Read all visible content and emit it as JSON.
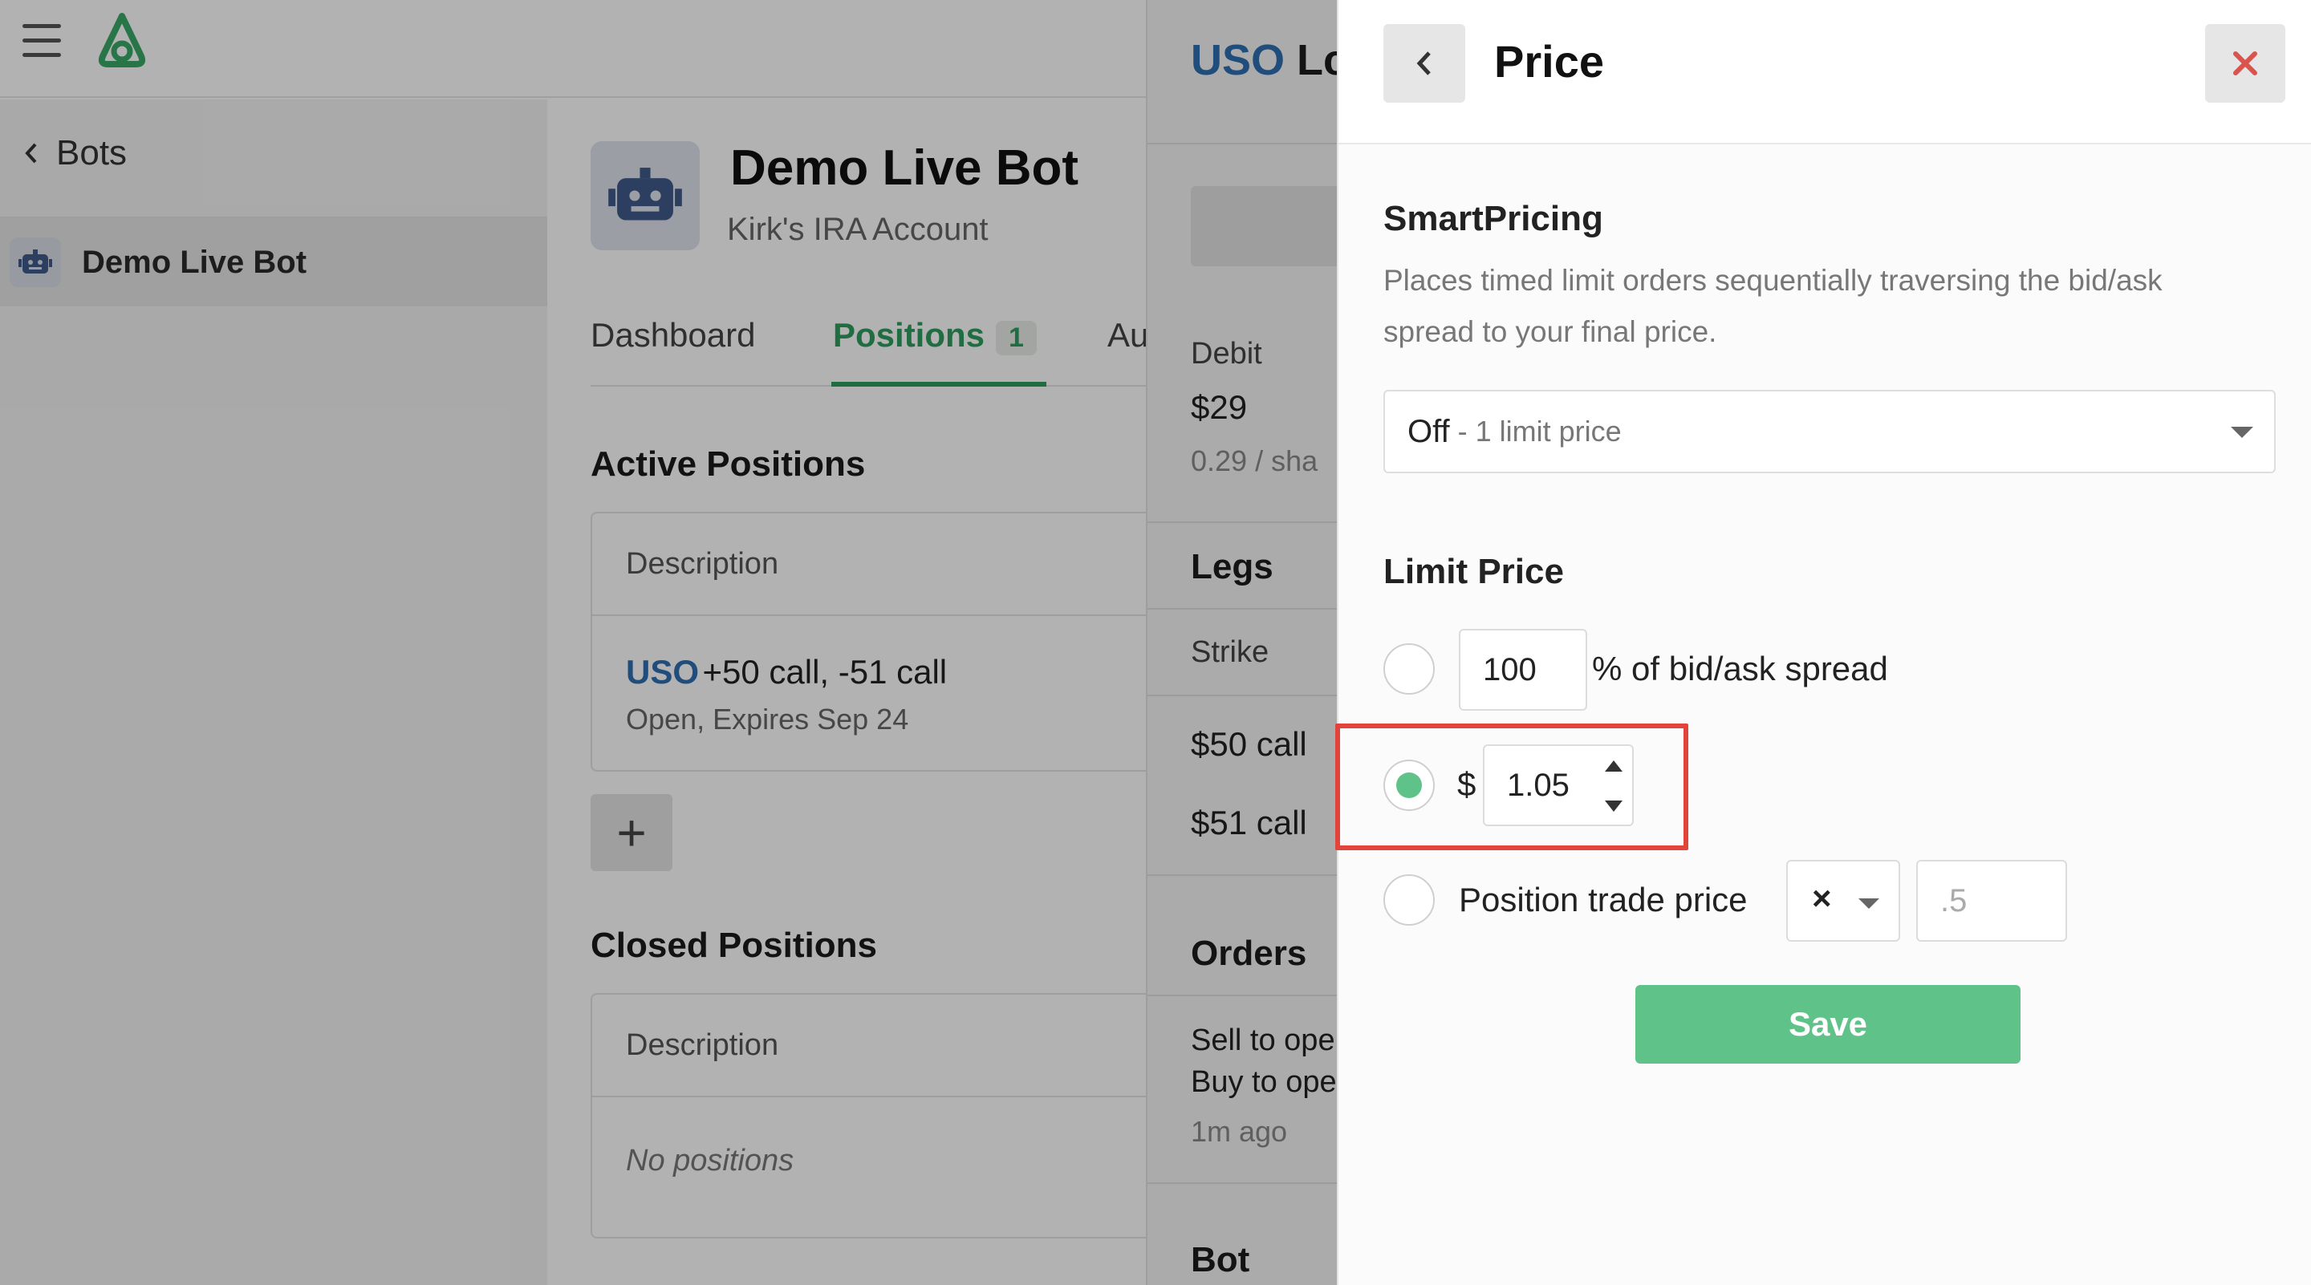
{
  "sidebar": {
    "back_label": "Bots",
    "active_item": "Demo Live Bot"
  },
  "bot": {
    "name": "Demo Live Bot",
    "account": "Kirk's IRA Account"
  },
  "tabs": [
    {
      "label": "Dashboard"
    },
    {
      "label": "Positions",
      "badge": "1"
    },
    {
      "label": "Au"
    }
  ],
  "active_positions": {
    "title": "Active Positions",
    "column": "Description",
    "row": {
      "symbol": "USO",
      "description": "+50 call, -51 call",
      "status": "Open, Expires Sep 24"
    }
  },
  "add_button_label": "+",
  "closed_positions": {
    "title": "Closed Positions",
    "column": "Description",
    "empty": "No positions"
  },
  "detail_drawer": {
    "symbol": "USO",
    "title_rest": "Lc",
    "debit_label": "Debit",
    "debit_value": "$29",
    "per_share": "0.29 / sha",
    "legs_title": "Legs",
    "strike_header": "Strike",
    "legs": [
      "$50 call",
      "$51 call"
    ],
    "orders_title": "Orders",
    "orders": [
      "Sell to ope",
      "Buy to ope"
    ],
    "orders_time": "1m ago",
    "bot_title": "Bot"
  },
  "price_panel": {
    "title": "Price",
    "smart_pricing": {
      "title": "SmartPricing",
      "description": "Places timed limit orders sequentially traversing the bid/ask spread to your final price.",
      "selected": "Off",
      "selected_sub": "- 1 limit price"
    },
    "limit_price": {
      "title": "Limit Price",
      "option_percent": {
        "value": "100",
        "label": "% of bid/ask spread"
      },
      "option_dollar": {
        "currency": "$",
        "value": "1.05"
      },
      "option_trade": {
        "label": "Position trade price",
        "operator": "×",
        "placeholder": ".5"
      }
    },
    "save_label": "Save"
  },
  "colors": {
    "accent_green": "#5fc389",
    "link_blue": "#2f6fb0",
    "highlight_red": "#e0443a",
    "close_red": "#d9534f"
  }
}
